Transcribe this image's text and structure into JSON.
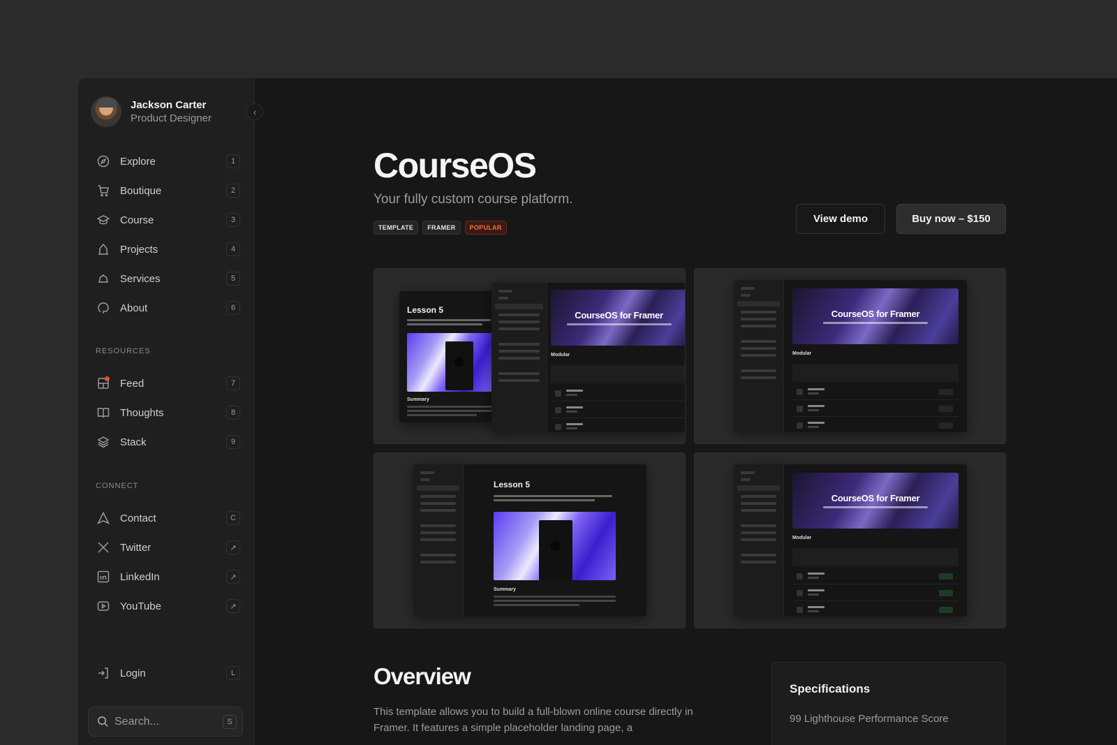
{
  "profile": {
    "name": "Jackson Carter",
    "role": "Product Designer"
  },
  "nav": [
    {
      "label": "Explore",
      "key": "1",
      "icon": "compass-icon"
    },
    {
      "label": "Boutique",
      "key": "2",
      "icon": "cart-icon"
    },
    {
      "label": "Course",
      "key": "3",
      "icon": "graduation-cap-icon"
    },
    {
      "label": "Projects",
      "key": "4",
      "icon": "house-icon"
    },
    {
      "label": "Services",
      "key": "5",
      "icon": "bell-icon"
    },
    {
      "label": "About",
      "key": "6",
      "icon": "speech-bubble-icon"
    }
  ],
  "resources": {
    "heading": "RESOURCES",
    "items": [
      {
        "label": "Feed",
        "key": "7",
        "icon": "feed-icon"
      },
      {
        "label": "Thoughts",
        "key": "8",
        "icon": "book-icon"
      },
      {
        "label": "Stack",
        "key": "9",
        "icon": "layers-icon"
      }
    ]
  },
  "connect": {
    "heading": "CONNECT",
    "items": [
      {
        "label": "Contact",
        "key": "C",
        "icon": "send-icon"
      },
      {
        "label": "Twitter",
        "key": "↗",
        "icon": "x-logo-icon"
      },
      {
        "label": "LinkedIn",
        "key": "↗",
        "icon": "linkedin-icon"
      },
      {
        "label": "YouTube",
        "key": "↗",
        "icon": "youtube-icon"
      }
    ]
  },
  "login": {
    "label": "Login",
    "key": "L"
  },
  "search": {
    "placeholder": "Search...",
    "key": "S"
  },
  "product": {
    "title": "CourseOS",
    "subtitle": "Your fully custom course platform.",
    "tags": [
      "TEMPLATE",
      "FRAMER",
      "POPULAR"
    ],
    "view_demo": "View demo",
    "buy": "Buy now – $150"
  },
  "gallery": {
    "hero_title": "CourseOS for Framer",
    "lesson_title": "Lesson 5",
    "modular_label": "Modular",
    "summary_label": "Summary"
  },
  "overview": {
    "title": "Overview",
    "text": "This template allows you to build a full-blown online course directly in Framer. It features a simple placeholder landing page, a"
  },
  "specs": {
    "title": "Specifications",
    "item": "99 Lighthouse Performance Score"
  },
  "colors": {
    "accent_popular": "#f2703f",
    "notify_dot": "#e5532d"
  }
}
